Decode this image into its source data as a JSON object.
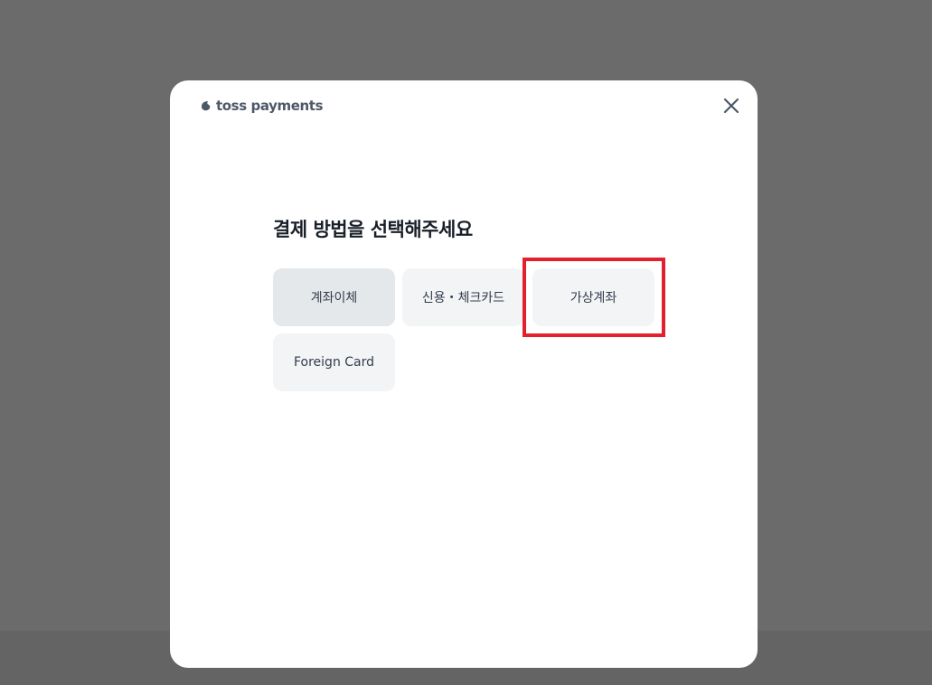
{
  "brand": {
    "logo_text": "toss payments",
    "logo_icon": "toss-logo-icon"
  },
  "header": {
    "close_icon": "close-icon"
  },
  "main": {
    "title": "결제 방법을 선택해주세요",
    "methods": [
      {
        "label": "계좌이체",
        "selected": true
      },
      {
        "label": "신용・체크카드",
        "selected": false
      },
      {
        "label": "가상계좌",
        "selected": false,
        "highlighted": true
      },
      {
        "label": "Foreign Card",
        "selected": false
      }
    ]
  },
  "colors": {
    "overlay": "#6b6b6b",
    "modal_bg": "#ffffff",
    "button_bg": "#f2f4f6",
    "button_selected_bg": "#e5e8eb",
    "highlight": "#e3212e",
    "title_text": "#191f28",
    "button_text": "#333d4b"
  }
}
